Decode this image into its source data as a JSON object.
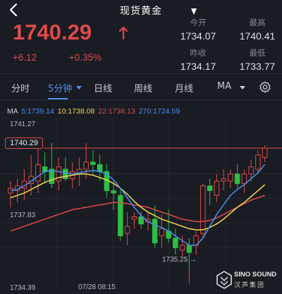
{
  "header": {
    "title": "现货黄金"
  },
  "quote": {
    "price": "1740.29",
    "change": "+6.12",
    "change_pct": "+0.35%",
    "up_color": "#e04a4a"
  },
  "stats": {
    "open": {
      "label": "今开",
      "value": "1734.07"
    },
    "high": {
      "label": "最高",
      "value": "1740.41"
    },
    "prev_close": {
      "label": "昨收",
      "value": "1734.17"
    },
    "low": {
      "label": "最低",
      "value": "1733.77"
    }
  },
  "tabs": [
    {
      "label": "分时"
    },
    {
      "label": "5分钟",
      "active": true
    },
    {
      "label": "日线"
    },
    {
      "label": "周线"
    },
    {
      "label": "月线"
    },
    {
      "label": "MA"
    }
  ],
  "ma_legend": {
    "ma5": {
      "label": "MA 5:1739.14",
      "prefix": "MA ",
      "text": "5:1739.14",
      "color": "#4a8ff0"
    },
    "ma10": {
      "label": "10:1738.08",
      "color": "#f3d650"
    },
    "ma22": {
      "label": "22:1738.13",
      "color": "#e04a4a"
    },
    "ma270": {
      "label": "270:1724.59",
      "color": "#4f8ef7"
    }
  },
  "axis": {
    "y_top": "1741.27",
    "y_mid": "1737.83",
    "y_bottom": "1734.39",
    "x_time": "07/28 08:15",
    "current_price_tag": "1740.29",
    "low_marker": "1735.25"
  },
  "watermark": {
    "brand": "SINO SOUND",
    "sub": "汉声集团"
  },
  "chart_data": {
    "type": "candlestick",
    "up_color": "#e04a4a",
    "down_color": "#2fbd45",
    "ylim": [
      1734.39,
      1741.27
    ],
    "candles": [
      {
        "o": 1738.4,
        "h": 1738.9,
        "l": 1737.8,
        "c": 1738.6
      },
      {
        "o": 1738.5,
        "h": 1739.0,
        "l": 1738.0,
        "c": 1738.7
      },
      {
        "o": 1738.6,
        "h": 1739.4,
        "l": 1738.1,
        "c": 1738.9
      },
      {
        "o": 1738.8,
        "h": 1740.0,
        "l": 1738.3,
        "c": 1739.1
      },
      {
        "o": 1738.9,
        "h": 1740.3,
        "l": 1738.4,
        "c": 1739.6
      },
      {
        "o": 1739.5,
        "h": 1740.1,
        "l": 1738.8,
        "c": 1739.3
      },
      {
        "o": 1739.4,
        "h": 1740.5,
        "l": 1738.6,
        "c": 1738.8
      },
      {
        "o": 1738.9,
        "h": 1739.9,
        "l": 1738.5,
        "c": 1739.5
      },
      {
        "o": 1739.4,
        "h": 1739.9,
        "l": 1738.9,
        "c": 1739.0
      },
      {
        "o": 1739.0,
        "h": 1739.7,
        "l": 1738.6,
        "c": 1739.3
      },
      {
        "o": 1739.2,
        "h": 1739.9,
        "l": 1738.7,
        "c": 1739.4
      },
      {
        "o": 1739.4,
        "h": 1740.5,
        "l": 1739.0,
        "c": 1739.7
      },
      {
        "o": 1739.7,
        "h": 1740.2,
        "l": 1739.2,
        "c": 1739.6
      },
      {
        "o": 1739.6,
        "h": 1740.0,
        "l": 1738.9,
        "c": 1739.3
      },
      {
        "o": 1739.3,
        "h": 1739.6,
        "l": 1738.2,
        "c": 1738.5
      },
      {
        "o": 1738.5,
        "h": 1738.9,
        "l": 1737.7,
        "c": 1738.4
      },
      {
        "o": 1738.3,
        "h": 1738.6,
        "l": 1736.4,
        "c": 1736.6
      },
      {
        "o": 1736.7,
        "h": 1737.6,
        "l": 1736.2,
        "c": 1737.0
      },
      {
        "o": 1737.3,
        "h": 1737.6,
        "l": 1736.9,
        "c": 1737.4
      },
      {
        "o": 1737.4,
        "h": 1737.6,
        "l": 1736.9,
        "c": 1737.1
      },
      {
        "o": 1737.2,
        "h": 1737.6,
        "l": 1736.8,
        "c": 1737.3
      },
      {
        "o": 1737.3,
        "h": 1737.9,
        "l": 1736.1,
        "c": 1736.3
      },
      {
        "o": 1736.6,
        "h": 1737.5,
        "l": 1736.1,
        "c": 1736.9
      },
      {
        "o": 1736.8,
        "h": 1737.7,
        "l": 1736.3,
        "c": 1736.5
      },
      {
        "o": 1736.5,
        "h": 1736.9,
        "l": 1735.8,
        "c": 1736.1
      },
      {
        "o": 1736.0,
        "h": 1736.6,
        "l": 1735.7,
        "c": 1736.2
      },
      {
        "o": 1736.2,
        "h": 1736.5,
        "l": 1735.25,
        "c": 1735.9
      },
      {
        "o": 1736.2,
        "h": 1736.8,
        "l": 1735.8,
        "c": 1736.6
      },
      {
        "o": 1736.7,
        "h": 1738.8,
        "l": 1736.5,
        "c": 1738.7
      },
      {
        "o": 1738.7,
        "h": 1739.0,
        "l": 1737.9,
        "c": 1738.5
      },
      {
        "o": 1738.3,
        "h": 1739.2,
        "l": 1738.0,
        "c": 1738.9
      },
      {
        "o": 1738.9,
        "h": 1739.4,
        "l": 1738.5,
        "c": 1739.0
      },
      {
        "o": 1738.9,
        "h": 1739.4,
        "l": 1738.6,
        "c": 1739.2
      },
      {
        "o": 1739.2,
        "h": 1739.6,
        "l": 1738.6,
        "c": 1738.8
      },
      {
        "o": 1738.8,
        "h": 1739.4,
        "l": 1738.4,
        "c": 1739.2
      },
      {
        "o": 1739.2,
        "h": 1739.8,
        "l": 1738.9,
        "c": 1739.5
      },
      {
        "o": 1739.4,
        "h": 1740.2,
        "l": 1739.2,
        "c": 1740.0
      },
      {
        "o": 1739.9,
        "h": 1740.41,
        "l": 1739.7,
        "c": 1740.29
      }
    ],
    "ma5": [
      1738.5,
      1738.55,
      1738.7,
      1738.9,
      1739.1,
      1739.3,
      1739.35,
      1739.3,
      1739.25,
      1739.2,
      1739.25,
      1739.3,
      1739.35,
      1739.3,
      1739.2,
      1738.95,
      1738.6,
      1738.2,
      1737.8,
      1737.45,
      1737.2,
      1737.05,
      1736.95,
      1736.8,
      1736.6,
      1736.4,
      1736.2,
      1736.2,
      1736.5,
      1737.0,
      1737.5,
      1737.9,
      1738.3,
      1738.55,
      1738.75,
      1739.0,
      1739.25,
      1739.6
    ],
    "ma10": [
      1738.2,
      1738.3,
      1738.4,
      1738.55,
      1738.7,
      1738.85,
      1738.95,
      1739.05,
      1739.1,
      1739.15,
      1739.2,
      1739.2,
      1739.15,
      1739.05,
      1738.95,
      1738.8,
      1738.6,
      1738.35,
      1738.05,
      1737.8,
      1737.6,
      1737.45,
      1737.3,
      1737.2,
      1737.1,
      1737.0,
      1736.9,
      1736.85,
      1736.85,
      1736.95,
      1737.1,
      1737.3,
      1737.55,
      1737.8,
      1738.0,
      1738.25,
      1738.5,
      1738.75
    ],
    "ma22": [
      1736.8,
      1736.9,
      1737.0,
      1737.1,
      1737.2,
      1737.3,
      1737.4,
      1737.5,
      1737.6,
      1737.7,
      1737.75,
      1737.8,
      1737.85,
      1737.9,
      1737.95,
      1738.0,
      1738.0,
      1737.95,
      1737.9,
      1737.85,
      1737.8,
      1737.7,
      1737.6,
      1737.5,
      1737.4,
      1737.3,
      1737.25,
      1737.2,
      1737.2,
      1737.25,
      1737.35,
      1737.5,
      1737.65,
      1737.8,
      1737.95,
      1738.1,
      1738.2,
      1738.3
    ]
  }
}
